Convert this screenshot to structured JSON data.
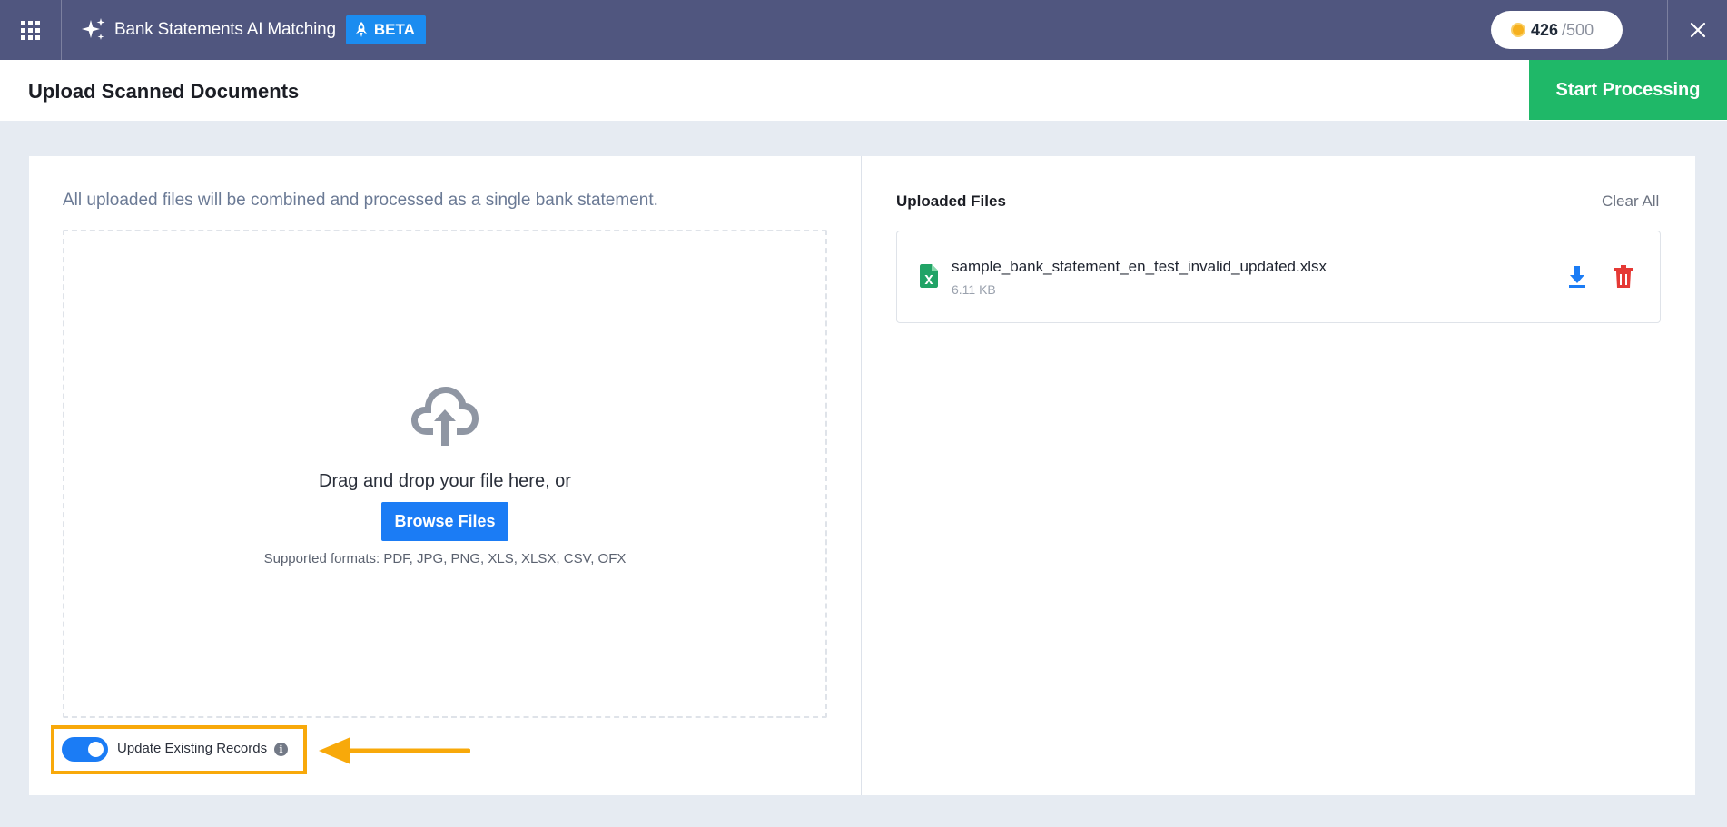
{
  "topbar": {
    "app_title": "Bank Statements AI Matching",
    "beta_label": "BETA",
    "credits_used": "426",
    "credits_total": "/500"
  },
  "header": {
    "page_title": "Upload Scanned Documents",
    "start_button": "Start Processing"
  },
  "upload": {
    "note": "All uploaded files will be combined and processed as a single bank statement.",
    "drag_text": "Drag and drop your file here, or",
    "browse_label": "Browse Files",
    "formats": "Supported formats: PDF, JPG, PNG, XLS, XLSX, CSV, OFX",
    "toggle_label": "Update Existing Records",
    "toggle_on": true
  },
  "files_panel": {
    "title": "Uploaded Files",
    "clear_all": "Clear All",
    "files": [
      {
        "name": "sample_bank_statement_en_test_invalid_updated.xlsx",
        "size": "6.11 KB"
      }
    ]
  },
  "colors": {
    "topbar": "#50567f",
    "accent_blue": "#1b7cf5",
    "start_green": "#1fb868",
    "highlight_orange": "#f8a90a",
    "delete_red": "#e53935"
  },
  "icons": [
    "apps-grid-icon",
    "sparkle-icon",
    "rocket-icon",
    "coin-icon",
    "close-icon",
    "cloud-upload-icon",
    "info-icon",
    "excel-file-icon",
    "download-icon",
    "trash-icon",
    "arrow-left-icon"
  ]
}
